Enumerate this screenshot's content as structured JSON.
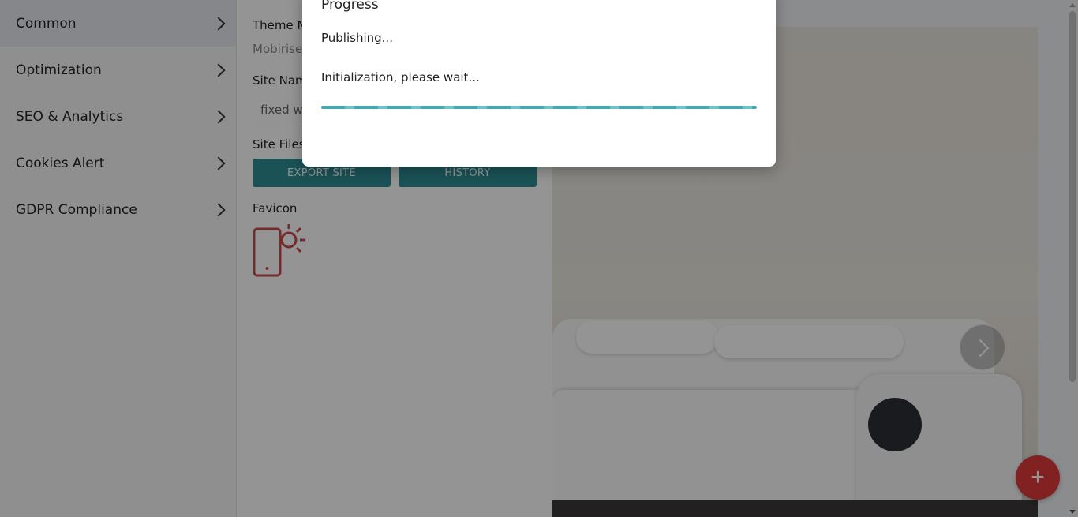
{
  "sidebar": {
    "items": [
      {
        "label": "Common"
      },
      {
        "label": "Optimization"
      },
      {
        "label": "SEO & Analytics"
      },
      {
        "label": "Cookies Alert"
      },
      {
        "label": "GDPR Compliance"
      }
    ]
  },
  "panel": {
    "theme_name_label": "Theme Na",
    "theme_name_value": "Mobirise",
    "site_name_label": "Site Nam",
    "site_name_value": "fixed wi",
    "site_files_label": "Site Files",
    "export_button": "EXPORT SITE",
    "history_button": "HISTORY",
    "favicon_label": "Favicon"
  },
  "preview": {
    "add_button": "+"
  },
  "modal": {
    "title": "Progress",
    "status": "Publishing...",
    "message": "Initialization, please wait..."
  },
  "colors": {
    "accent": "#2d8e94",
    "fab": "#e03a3a",
    "favicon": "#c94a4a",
    "progress": "#43aab2"
  },
  "icons": {
    "sidebar_chevron": "chevron-right-icon",
    "favicon": "phone-sun-icon",
    "slider_next": "chevron-right-icon",
    "fab": "plus-icon"
  }
}
